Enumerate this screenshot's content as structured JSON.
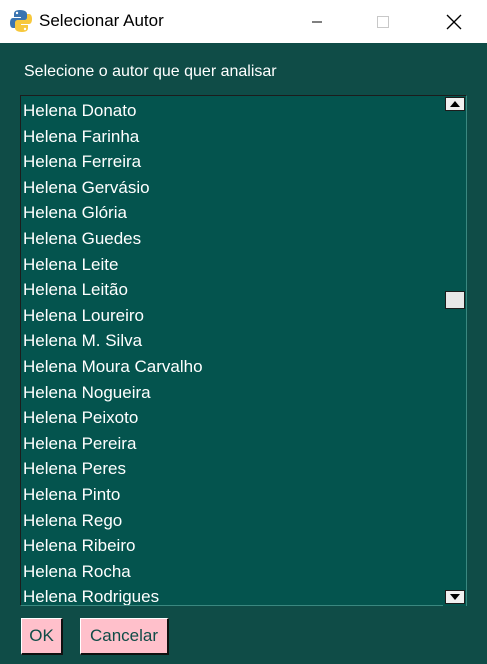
{
  "window": {
    "title": "Selecionar Autor"
  },
  "prompt": "Selecione o autor que quer analisar",
  "authors": [
    "Helena Donato",
    "Helena Farinha",
    "Helena Ferreira",
    "Helena Gervásio",
    "Helena Glória",
    "Helena Guedes",
    "Helena Leite",
    "Helena Leitão",
    "Helena Loureiro",
    "Helena M. Silva",
    "Helena Moura Carvalho",
    "Helena Nogueira",
    "Helena Peixoto",
    "Helena Pereira",
    "Helena Peres",
    "Helena Pinto",
    "Helena Rego",
    "Helena Ribeiro",
    "Helena Rocha",
    "Helena Rodrigues"
  ],
  "scroll": {
    "position_fraction": 0.39
  },
  "buttons": {
    "ok_label": "OK",
    "cancel_label": "Cancelar"
  },
  "icons": {
    "app": "python-logo-icon",
    "minimize": "minimize-icon",
    "maximize": "maximize-icon",
    "close": "close-icon"
  },
  "colors": {
    "background": "#0f4c47",
    "list_background": "#04544e",
    "button_background": "#ffc0cb",
    "button_text": "#0f4c47",
    "text": "#ffffff"
  }
}
